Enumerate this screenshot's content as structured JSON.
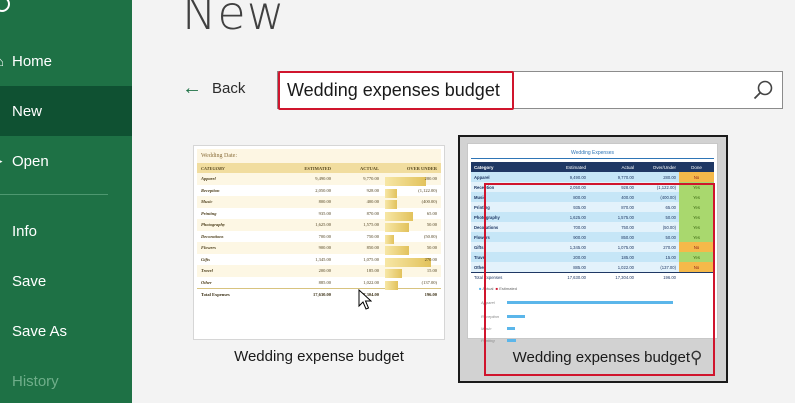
{
  "sidebar": {
    "items": [
      {
        "label": "Home",
        "state": "normal"
      },
      {
        "label": "New",
        "state": "active"
      },
      {
        "label": "Open",
        "state": "normal"
      },
      {
        "label": "Info",
        "state": "normal"
      },
      {
        "label": "Save",
        "state": "normal"
      },
      {
        "label": "Save As",
        "state": "normal"
      },
      {
        "label": "History",
        "state": "disabled"
      }
    ],
    "color": "#1e7145",
    "active_color": "#0f5132"
  },
  "header": {
    "title": "New"
  },
  "nav": {
    "back_label": "Back"
  },
  "search": {
    "value": "Wedding expenses budget",
    "icon": "search-icon"
  },
  "templates": [
    {
      "label": "Wedding expense budget",
      "preview": {
        "title": "Wedding Date:",
        "columns": [
          "CATEGORY",
          "ESTIMATED",
          "ACTUAL",
          "OVER UNDER"
        ],
        "rows": [
          [
            "Apparel",
            "9,490.00",
            "9,770.00",
            "280.00"
          ],
          [
            "Reception",
            "2,050.00",
            "928.00",
            "(1,122.00)"
          ],
          [
            "Music",
            "800.00",
            "400.00",
            "(400.00)"
          ],
          [
            "Printing",
            "935.00",
            "870.00",
            "65.00"
          ],
          [
            "Photography",
            "1,625.00",
            "1,575.00",
            "50.00"
          ],
          [
            "Decorations",
            "700.00",
            "750.00",
            "(50.00)"
          ],
          [
            "Flowers",
            "900.00",
            "850.00",
            "50.00"
          ],
          [
            "Gifts",
            "1,345.00",
            "1,075.00",
            "270.00"
          ],
          [
            "Travel",
            "200.00",
            "185.00",
            "15.00"
          ],
          [
            "Other",
            "885.00",
            "1,022.00",
            "(137.00)"
          ]
        ],
        "total": [
          "Total Expenses",
          "17,630.00",
          "17,304.00",
          "196.00"
        ]
      }
    },
    {
      "label": "Wedding expenses budget",
      "pin_icon": "pin-icon",
      "preview": {
        "title": "Wedding Expenses",
        "columns": [
          "Category",
          "Estimated",
          "Actual",
          "Over/Under",
          "Done"
        ],
        "rows": [
          [
            "Apparel",
            "9,490.00",
            "9,770.00",
            "280.00",
            "No"
          ],
          [
            "Reception",
            "2,050.00",
            "928.00",
            "(1,122.00)",
            "Yes"
          ],
          [
            "Music",
            "800.00",
            "400.00",
            "(400.00)",
            "Yes"
          ],
          [
            "Printing",
            "935.00",
            "870.00",
            "65.00",
            "Yes"
          ],
          [
            "Photography",
            "1,625.00",
            "1,575.00",
            "50.00",
            "Yes"
          ],
          [
            "Decorations",
            "700.00",
            "750.00",
            "(50.00)",
            "Yes"
          ],
          [
            "Flowers",
            "900.00",
            "850.00",
            "50.00",
            "Yes"
          ],
          [
            "Gifts",
            "1,345.00",
            "1,075.00",
            "270.00",
            "No"
          ],
          [
            "Travel",
            "200.00",
            "185.00",
            "15.00",
            "Yes"
          ],
          [
            "Other",
            "885.00",
            "1,022.00",
            "(137.00)",
            "No"
          ]
        ],
        "total": [
          "Total Expenses",
          "17,630.00",
          "17,304.00",
          "196.00"
        ],
        "legend": [
          "Actual",
          "Estimated"
        ],
        "chart_labels": [
          "Apparel",
          "Reception",
          "Music",
          "Printing"
        ]
      }
    }
  ],
  "highlight_color": "#d0152d"
}
